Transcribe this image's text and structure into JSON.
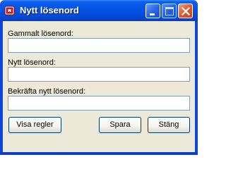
{
  "window": {
    "title": "Nytt lösenord",
    "icon": "key-lock-icon",
    "controls": [
      "minimize-icon",
      "maximize-icon",
      "close-icon"
    ]
  },
  "form": {
    "old_password": {
      "label": "Gammalt lösenord:",
      "value": ""
    },
    "new_password": {
      "label": "Nytt lösenord:",
      "value": ""
    },
    "confirm_password": {
      "label": "Bekräfta nytt lösenord:",
      "value": ""
    }
  },
  "buttons": {
    "show_rules": "Visa regler",
    "save": "Spara",
    "close": "Stäng"
  },
  "colors": {
    "titlebar": "#0453e3",
    "client_bg": "#ece9d8",
    "input_border": "#7f9db9",
    "close_button": "#e05a2e"
  }
}
